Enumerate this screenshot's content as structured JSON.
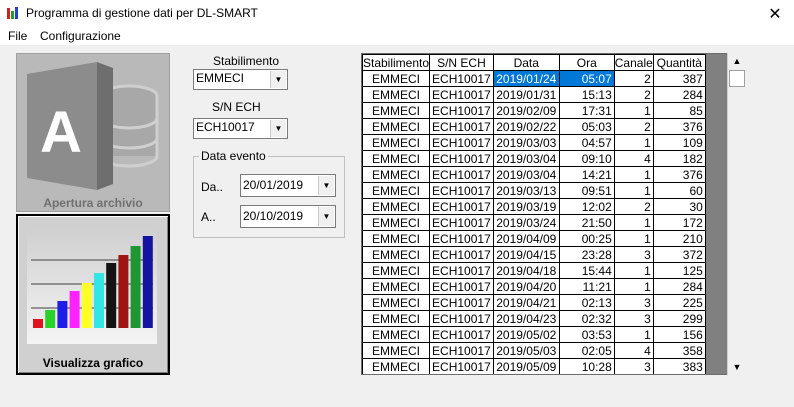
{
  "window": {
    "title": "Programma di gestione dati per DL-SMART",
    "close_glyph": "✕"
  },
  "menu": [
    {
      "label": "File"
    },
    {
      "label": "Configurazione"
    }
  ],
  "left_buttons": {
    "open": {
      "label": "Apertura archivio",
      "icon": "database-access-icon"
    },
    "chart": {
      "label": "Visualizza grafico",
      "icon": "bar-chart-icon"
    }
  },
  "filters": {
    "stabilimento_label": "Stabilimento",
    "stabilimento_value": "EMMECI",
    "sn_label": "S/N ECH",
    "sn_value": "ECH10017",
    "group_title": "Data evento",
    "da_label": "Da..",
    "da_value": "20/01/2019",
    "a_label": "A..",
    "a_value": "20/10/2019"
  },
  "table": {
    "headers": [
      "Stabilimento",
      "S/N ECH",
      "Data",
      "Ora",
      "Canale",
      "Quantità"
    ],
    "rows": [
      [
        "EMMECI",
        "ECH10017",
        "2019/01/24",
        "05:07",
        "2",
        "387"
      ],
      [
        "EMMECI",
        "ECH10017",
        "2019/01/31",
        "15:13",
        "2",
        "284"
      ],
      [
        "EMMECI",
        "ECH10017",
        "2019/02/09",
        "17:31",
        "1",
        "85"
      ],
      [
        "EMMECI",
        "ECH10017",
        "2019/02/22",
        "05:03",
        "2",
        "376"
      ],
      [
        "EMMECI",
        "ECH10017",
        "2019/03/03",
        "04:57",
        "1",
        "109"
      ],
      [
        "EMMECI",
        "ECH10017",
        "2019/03/04",
        "09:10",
        "4",
        "182"
      ],
      [
        "EMMECI",
        "ECH10017",
        "2019/03/04",
        "14:21",
        "1",
        "376"
      ],
      [
        "EMMECI",
        "ECH10017",
        "2019/03/13",
        "09:51",
        "1",
        "60"
      ],
      [
        "EMMECI",
        "ECH10017",
        "2019/03/19",
        "12:02",
        "2",
        "30"
      ],
      [
        "EMMECI",
        "ECH10017",
        "2019/03/24",
        "21:50",
        "1",
        "172"
      ],
      [
        "EMMECI",
        "ECH10017",
        "2019/04/09",
        "00:25",
        "1",
        "210"
      ],
      [
        "EMMECI",
        "ECH10017",
        "2019/04/15",
        "23:28",
        "3",
        "372"
      ],
      [
        "EMMECI",
        "ECH10017",
        "2019/04/18",
        "15:44",
        "1",
        "125"
      ],
      [
        "EMMECI",
        "ECH10017",
        "2019/04/20",
        "11:21",
        "1",
        "284"
      ],
      [
        "EMMECI",
        "ECH10017",
        "2019/04/21",
        "02:13",
        "3",
        "225"
      ],
      [
        "EMMECI",
        "ECH10017",
        "2019/04/23",
        "02:32",
        "3",
        "299"
      ],
      [
        "EMMECI",
        "ECH10017",
        "2019/05/02",
        "03:53",
        "1",
        "156"
      ],
      [
        "EMMECI",
        "ECH10017",
        "2019/05/03",
        "02:05",
        "4",
        "358"
      ],
      [
        "EMMECI",
        "ECH10017",
        "2019/05/09",
        "10:28",
        "3",
        "383"
      ]
    ],
    "selected_row": 0
  },
  "colors": {
    "selection": "#0078d7",
    "grid_background": "#808080"
  },
  "chart_bar_colors": [
    "#e0141e",
    "#28d228",
    "#1e1ee6",
    "#ff22ff",
    "#ffff28",
    "#32e6e6",
    "#141414",
    "#a01414",
    "#1e9632",
    "#1414a0"
  ]
}
